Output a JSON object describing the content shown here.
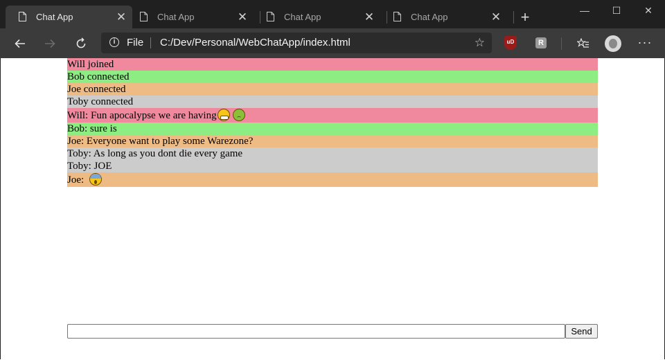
{
  "browser": {
    "tabs": [
      {
        "title": "Chat App",
        "active": true
      },
      {
        "title": "Chat App",
        "active": false
      },
      {
        "title": "Chat App",
        "active": false
      },
      {
        "title": "Chat App",
        "active": false
      }
    ],
    "new_tab_glyph": "+",
    "window_controls": {
      "minimize": "—",
      "maximize": "☐",
      "close": "✕"
    },
    "address": {
      "scheme_label": "File",
      "url": "C:/Dev/Personal/WebChatApp/index.html"
    },
    "icons": {
      "back": "back-arrow-icon",
      "forward": "forward-arrow-icon",
      "refresh": "refresh-icon",
      "info": "info-icon",
      "favorite": "star-icon",
      "ublock": "ublock-origin-icon",
      "extension": "r-extension-icon",
      "favorites": "favorites-icon",
      "profile": "profile-avatar",
      "more": "more-icon"
    }
  },
  "chat": {
    "colors": {
      "Will": "#f0899e",
      "Bob": "#8ded82",
      "Joe": "#eebb84",
      "Toby": "#cccccc"
    },
    "messages": [
      {
        "text": "Will joined",
        "user": "Will",
        "emojis": []
      },
      {
        "text": "Bob connected",
        "user": "Bob",
        "emojis": []
      },
      {
        "text": "Joe connected",
        "user": "Joe",
        "emojis": []
      },
      {
        "text": "Toby connected",
        "user": "Toby",
        "emojis": []
      },
      {
        "text": "Will: Fun apocalypse we are having",
        "user": "Will",
        "emojis": [
          "grimacing-face-icon",
          "nauseated-face-icon"
        ]
      },
      {
        "text": "Bob: sure is",
        "user": "Bob",
        "emojis": []
      },
      {
        "text": "Joe: Everyone want to play some Warezone?",
        "user": "Joe",
        "emojis": []
      },
      {
        "text": "Toby: As long as you dont die every game",
        "user": "Toby",
        "emojis": []
      },
      {
        "text": "Toby: JOE",
        "user": "Toby",
        "emojis": []
      },
      {
        "text": "Joe: ",
        "user": "Joe",
        "emojis": [
          "screaming-face-icon"
        ]
      }
    ],
    "input_value": "",
    "send_label": "Send"
  }
}
